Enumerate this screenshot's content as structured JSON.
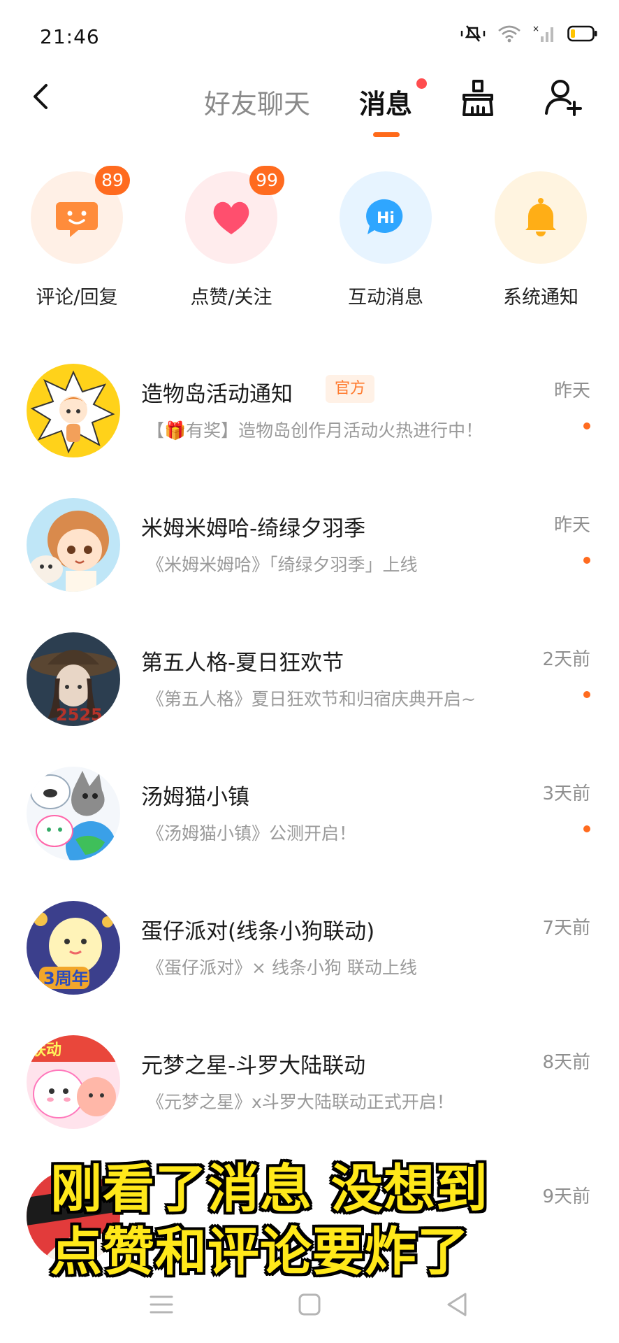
{
  "status": {
    "time": "21:46"
  },
  "nav": {
    "tab_friends": "好友聊天",
    "tab_messages": "消息"
  },
  "categories": [
    {
      "label": "评论/回复",
      "badge": "89",
      "color": "#ff8c3b",
      "bg": "#fff0e6",
      "icon": "comment-icon"
    },
    {
      "label": "点赞/关注",
      "badge": "99",
      "color": "#ff4f6e",
      "bg": "#ffeced",
      "icon": "heart-icon"
    },
    {
      "label": "互动消息",
      "badge": "",
      "color": "#2fa6ff",
      "bg": "#e7f4ff",
      "icon": "hi-icon"
    },
    {
      "label": "系统通知",
      "badge": "",
      "color": "#ffae16",
      "bg": "#fff4e0",
      "icon": "bell-icon"
    }
  ],
  "messages": [
    {
      "title": "造物岛活动通知",
      "tag": "官方",
      "preview": "【🎁有奖】造物岛创作月活动火热进行中！",
      "time": "昨天",
      "unread": true
    },
    {
      "title": "米姆米姆哈-绮绿夕羽季",
      "tag": "",
      "preview": "《米姆米姆哈》「绮绿夕羽季」上线",
      "time": "昨天",
      "unread": true
    },
    {
      "title": "第五人格-夏日狂欢节",
      "tag": "",
      "preview": "《第五人格》夏日狂欢节和归宿庆典开启~",
      "time": "2天前",
      "unread": true
    },
    {
      "title": "汤姆猫小镇",
      "tag": "",
      "preview": "《汤姆猫小镇》公测开启！",
      "time": "3天前",
      "unread": true
    },
    {
      "title": "蛋仔派对(线条小狗联动)",
      "tag": "",
      "preview": "《蛋仔派对》× 线条小狗 联动上线",
      "time": "7天前",
      "unread": false
    },
    {
      "title": "元梦之星-斗罗大陆联动",
      "tag": "",
      "preview": "《元梦之星》x斗罗大陆联动正式开启！",
      "time": "8天前",
      "unread": false
    },
    {
      "title": "",
      "tag": "",
      "preview": "",
      "time": "9天前",
      "unread": false
    }
  ],
  "avatar_texts": {
    "identity_v": "2525",
    "eggy_party": "3周年",
    "star_of_dream": "联动"
  },
  "subtitle": {
    "line1": "刚看了消息 没想到",
    "line2": "点赞和评论要炸了"
  },
  "colors": {
    "accent": "#ff6a1a",
    "red_dot": "#ff4d4f",
    "subtitle": "#ffe81a"
  }
}
